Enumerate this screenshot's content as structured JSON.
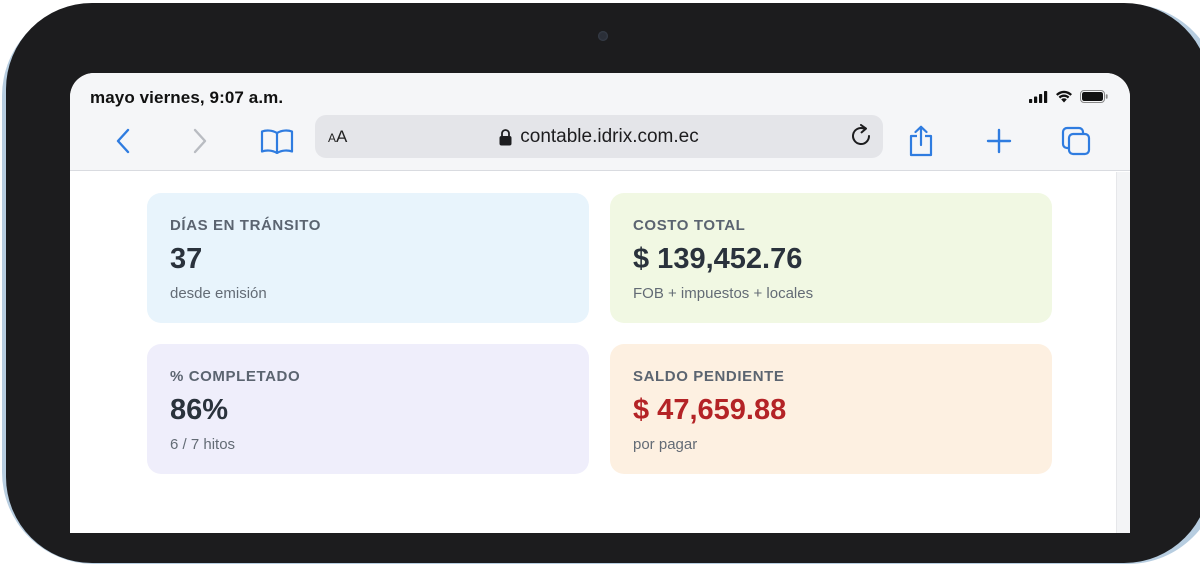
{
  "status_bar": {
    "time": "mayo viernes, 9:07 a.m."
  },
  "browser": {
    "text_size_label_small": "A",
    "text_size_label_large": "A",
    "url": "contable.idrix.com.ec",
    "icons": [
      "back-chevron-icon",
      "forward-chevron-icon",
      "bookmarks-book-icon",
      "lock-icon",
      "reload-icon",
      "share-icon",
      "plus-icon",
      "tabs-icon"
    ]
  },
  "cards": [
    {
      "label": "DÍAS EN TRÁNSITO",
      "value": "37",
      "sub": "desde emisión",
      "bg": "#e8f4fc",
      "value_color": "#2a323c"
    },
    {
      "label": "COSTO TOTAL",
      "value": "$ 139,452.76",
      "sub": "FOB + impuestos + locales",
      "bg": "#f1f8e3",
      "value_color": "#2a323c"
    },
    {
      "label": "% COMPLETADO",
      "value": "86%",
      "sub": "6 / 7 hitos",
      "bg": "#efeefb",
      "value_color": "#2a323c"
    },
    {
      "label": "SALDO PENDIENTE",
      "value": "$ 47,659.88",
      "sub": "por pagar",
      "bg": "#fdf0e1",
      "value_color": "#b42326"
    }
  ],
  "colors": {
    "accent": "#2f7ce0",
    "disabled": "#b9bcc2"
  }
}
